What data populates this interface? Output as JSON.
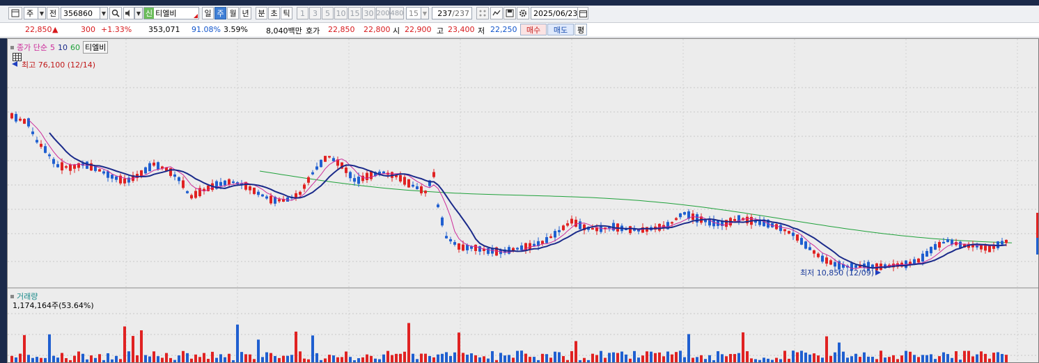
{
  "toolbar": {
    "period_unit": "주",
    "prev_label": "전",
    "code": "356860",
    "stock_flag": "신",
    "stock_name": "티엘비",
    "period_buttons": [
      "일",
      "주",
      "월",
      "년"
    ],
    "time_buttons": [
      "분",
      "초",
      "틱"
    ],
    "interval_buttons": [
      "1",
      "3",
      "5",
      "10",
      "15",
      "30",
      "200",
      "480"
    ],
    "interval_value": "15",
    "count_current": "237",
    "count_total": "/237",
    "date": "2025/06/23"
  },
  "quote": {
    "price": "22,850",
    "change_sign": "▲",
    "change": "300",
    "change_pct": "+1.33%",
    "volume": "353,071",
    "ratio1": "91.08%",
    "ratio2": "3.59%",
    "amount": "8,040백만",
    "bid_label": "호가",
    "ask_price": "22,850",
    "bid_price": "22,800",
    "open_label": "시",
    "open": "22,900",
    "high_label": "고",
    "high": "23,400",
    "low_label": "저",
    "low": "22,250",
    "buy_label": "매수",
    "sell_label": "매도",
    "eval_label": "평"
  },
  "price_panel": {
    "legend_main": "종가 단순",
    "ma_periods": [
      "5",
      "10",
      "60"
    ],
    "stock_tag": "티엘비",
    "high_note": "최고 76,100 (12/14)",
    "low_note": "최저 10,850 (12/09)"
  },
  "volume_panel": {
    "title": "거래량",
    "value": "1,174,164주(53.64%)"
  },
  "colors": {
    "up": "#e02222",
    "down": "#1f5fd0",
    "ma5": "#cc2a9a",
    "ma10": "#1a2a8a",
    "ma60": "#1fa13a"
  },
  "chart_data": {
    "type": "candlestick",
    "ohlc_tail_last": {
      "open": 22900,
      "high": 23400,
      "low": 22250,
      "close": 22850
    },
    "period_high": 76100,
    "period_low": 10850
  }
}
